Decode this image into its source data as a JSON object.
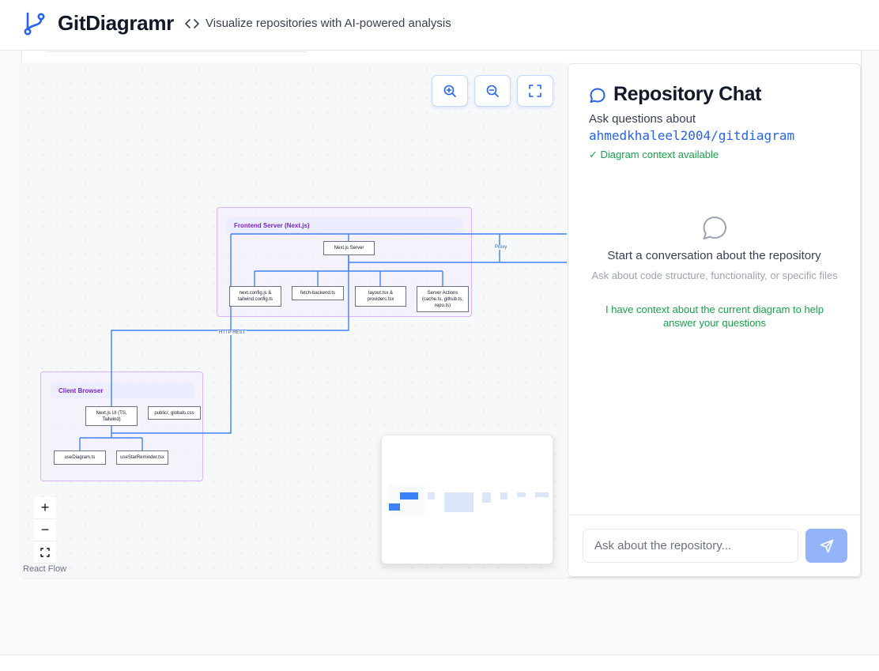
{
  "header": {
    "title": "GitDiagramr",
    "tagline": "Visualize repositories with AI-powered analysis"
  },
  "flow": {
    "groups": {
      "frontend": "Frontend Server (Next.js)",
      "client": "Client Browser"
    },
    "nodes": {
      "nextjs_server": "Next.js Server",
      "next_config": "next.config.js & tailwind.config.ts",
      "fetch_backend": "fetch-backend.ts",
      "layout": "layout.tsx & providers.tsx",
      "server_actions": "Server Actions (cache.ts, github.ts, repo.ts)",
      "nextjs_ui": "Next.js UI (TS, Tailwind)",
      "public_globals": "public/, globals.css",
      "use_diagram": "useDiagram.ts",
      "use_starrer": "useStarReminder.tsx"
    },
    "edge_labels": {
      "proxy": "Proxy",
      "http_rest": "HTTP REST"
    },
    "controls": {
      "zoom_in": "+",
      "zoom_out": "−"
    },
    "attribution": "React Flow"
  },
  "chat": {
    "title": "Repository Chat",
    "subtitle": "Ask questions about",
    "repo": "ahmedkhaleel2004/gitdiagram",
    "context_status": "✓ Diagram context available",
    "empty_title": "Start a conversation about the repository",
    "empty_subtitle": "Ask about code structure, functionality, or specific files",
    "empty_context": "I have context about the current diagram to help answer your questions",
    "input_placeholder": "Ask about the repository..."
  },
  "colors": {
    "accent": "#2563eb",
    "success": "#16a34a",
    "group_border": "#d8b4fe",
    "group_title": "#7e22ce",
    "send_button": "#93b4f8"
  }
}
